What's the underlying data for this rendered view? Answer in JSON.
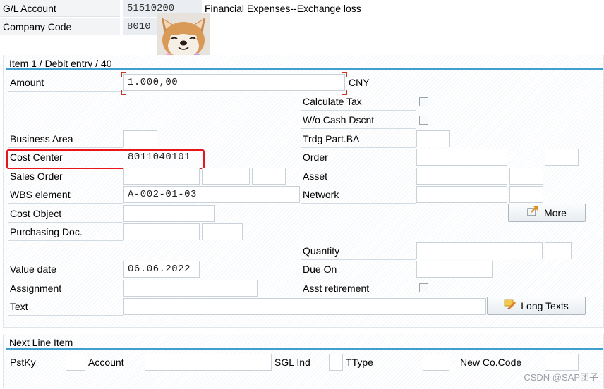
{
  "header": {
    "gl_account_label": "G/L Account",
    "gl_account_value": "51510200",
    "gl_account_desc": "Financial Expenses--Exchange loss",
    "company_code_label": "Company Code",
    "company_code_value": "8010"
  },
  "item_section": {
    "title": "Item 1 / Debit entry / 40",
    "amount_label": "Amount",
    "amount_value": "1.000,00",
    "currency": "CNY",
    "calculate_tax_label": "Calculate Tax",
    "wo_cash_dscnt_label": "W/o Cash Dscnt",
    "business_area_label": "Business Area",
    "business_area_value": "",
    "trdg_part_ba_label": "Trdg Part.BA",
    "trdg_part_ba_value": "",
    "cost_center_label": "Cost Center",
    "cost_center_value": "8011040101",
    "order_label": "Order",
    "order_value": "",
    "sales_order_label": "Sales Order",
    "asset_label": "Asset",
    "wbs_label": "WBS element",
    "wbs_value": "A-002-01-03",
    "network_label": "Network",
    "cost_object_label": "Cost Object",
    "more_button": "More",
    "purchasing_doc_label": "Purchasing Doc.",
    "quantity_label": "Quantity",
    "value_date_label": "Value date",
    "value_date_value": "06.06.2022",
    "due_on_label": "Due On",
    "assignment_label": "Assignment",
    "assignment_value": "",
    "asst_retirement_label": "Asst retirement",
    "text_label": "Text",
    "text_value": "",
    "long_texts_button": "Long Texts"
  },
  "next_line": {
    "title": "Next Line Item",
    "pstky_label": "PstKy",
    "account_label": "Account",
    "sgl_ind_label": "SGL Ind",
    "ttype_label": "TType",
    "new_co_code_label": "New Co.Code"
  },
  "watermark": "CSDN @SAP团子",
  "icons": {
    "more": "arrow-out-icon",
    "long_texts": "pencil-note-icon",
    "sticker": "shiba-dog-sticker"
  },
  "colors": {
    "section_rule": "#3fa0d0",
    "highlight": "#e8161b"
  }
}
